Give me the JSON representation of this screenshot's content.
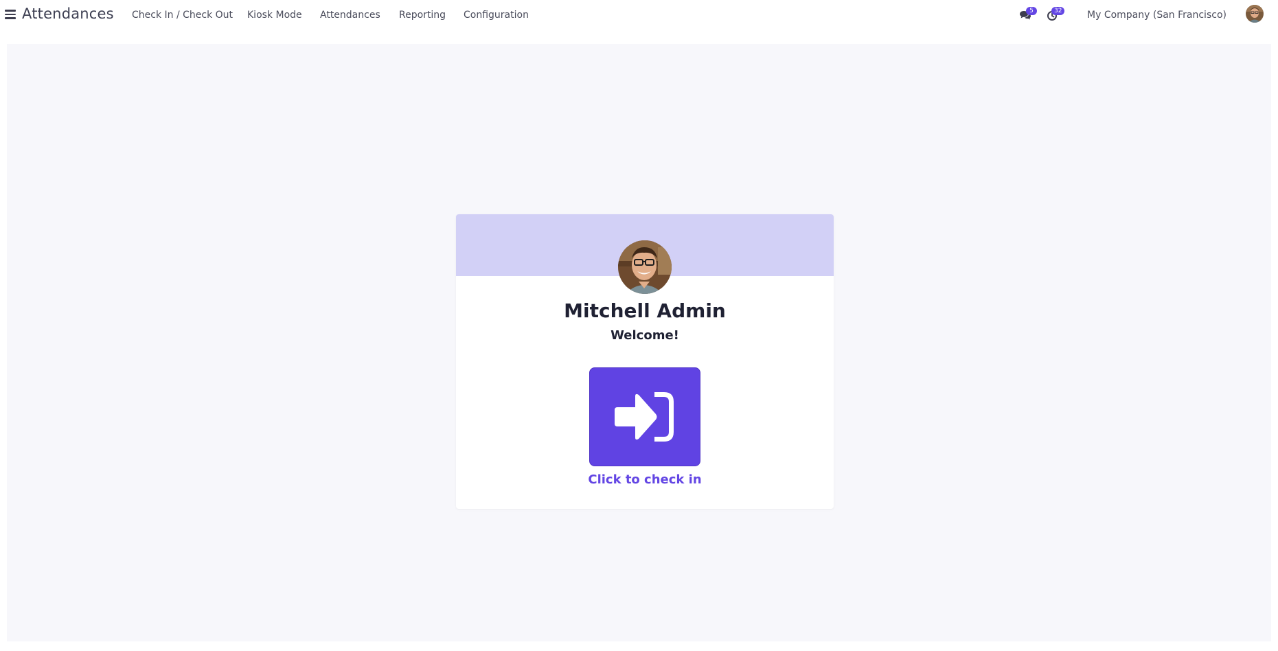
{
  "navbar": {
    "app_name": "Attendances",
    "menu_icon": "hamburger-menu-icon",
    "items": [
      {
        "label": "Check In / Check Out"
      },
      {
        "label": "Kiosk Mode"
      },
      {
        "label": "Attendances"
      },
      {
        "label": "Reporting"
      },
      {
        "label": "Configuration"
      }
    ],
    "systray": {
      "messages_icon": "chat-bubbles-icon",
      "messages_count": "5",
      "activities_icon": "clock-icon",
      "activities_count": "32",
      "company": "My Company (San Francisco)",
      "user_avatar_icon": "user-avatar"
    }
  },
  "card": {
    "employee_name": "Mitchell Admin",
    "greeting": "Welcome!",
    "button_icon": "sign-in-arrow-icon",
    "button_label": "Click to check in"
  },
  "colors": {
    "accent": "#6346e4",
    "header_band": "#d2d0f6",
    "background": "#f7f7fb"
  }
}
